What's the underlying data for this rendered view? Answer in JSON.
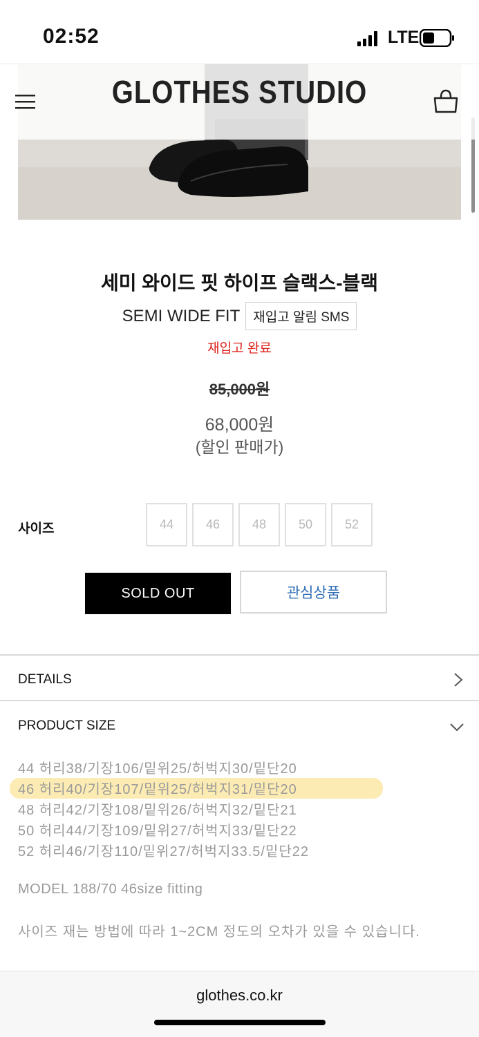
{
  "status_bar": {
    "time": "02:52",
    "network": "LTE"
  },
  "header": {
    "brand": "GLOTHES STUDIO"
  },
  "product": {
    "title": "세미 와이드 핏 하이프 슬랙스-블랙",
    "subtitle": "SEMI WIDE FIT",
    "restock_button": "재입고 알림 SMS",
    "restock_status": "재입고 완료",
    "original_price": "85,000원",
    "sale_price": "68,000원",
    "sale_note": "(할인 판매가)"
  },
  "size_selector": {
    "label": "사이즈",
    "options": [
      "44",
      "46",
      "48",
      "50",
      "52"
    ]
  },
  "actions": {
    "sold_out": "SOLD OUT",
    "wishlist": "관심상품"
  },
  "accordions": {
    "details": "DETAILS",
    "product_size": "PRODUCT SIZE"
  },
  "size_chart": {
    "rows": [
      "44 허리38/기장106/밑위25/허벅지30/밑단20",
      "46 허리40/기장107/밑위25/허벅지31/밑단20",
      "48 허리42/기장108/밑위26/허벅지32/밑단21",
      "50 허리44/기장109/밑위27/허벅지33/밑단22",
      "52 허리46/기장110/밑위27/허벅지33.5/밑단22"
    ],
    "highlighted_row": 1,
    "model_note": "MODEL 188/70 46size fitting",
    "notice": "사이즈 재는 방법에 따라 1~2CM 정도의 오차가 있을 수 있습니다."
  },
  "browser": {
    "url": "glothes.co.kr"
  },
  "colors": {
    "accent_red": "#e0211b",
    "link_blue": "#2f6db6",
    "highlight": "#fbe7a6"
  }
}
